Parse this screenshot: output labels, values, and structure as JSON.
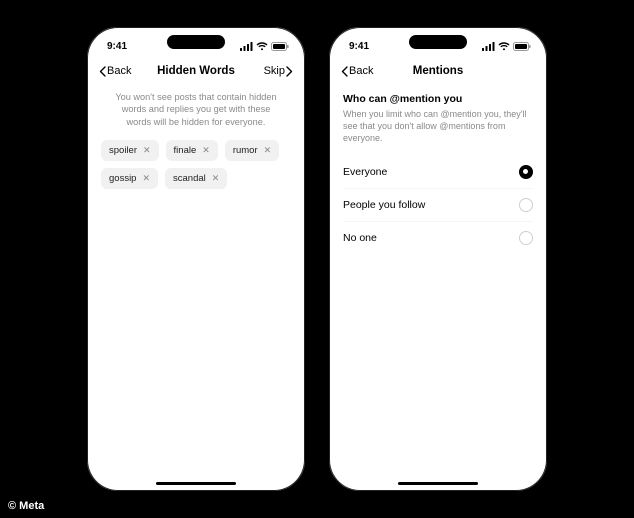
{
  "status": {
    "time": "9:41"
  },
  "phone1": {
    "nav": {
      "back": "Back",
      "title": "Hidden Words",
      "skip": "Skip"
    },
    "description": "You won't see posts that contain hidden words and replies you get with these words will be hidden for everyone.",
    "chips": [
      "spoiler",
      "finale",
      "rumor",
      "gossip",
      "scandal"
    ]
  },
  "phone2": {
    "nav": {
      "back": "Back",
      "title": "Mentions"
    },
    "section": {
      "title": "Who can @mention you",
      "subtitle": "When you limit who can @mention you, they'll see that you don't allow @mentions from everyone."
    },
    "options": [
      {
        "label": "Everyone",
        "selected": true
      },
      {
        "label": "People you follow",
        "selected": false
      },
      {
        "label": "No one",
        "selected": false
      }
    ]
  },
  "credit": "© Meta"
}
